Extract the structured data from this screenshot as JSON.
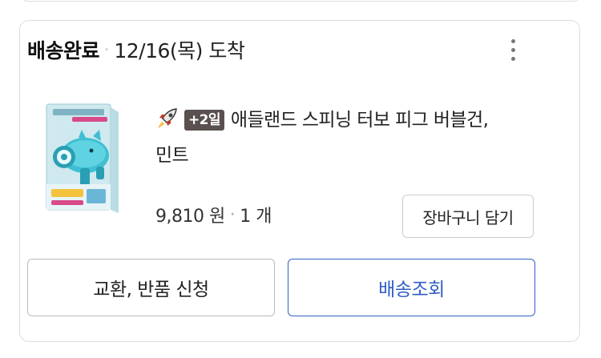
{
  "order": {
    "status": "배송완료",
    "separator": "·",
    "arrival": "12/16(목) 도착"
  },
  "product": {
    "badge": "+2일",
    "title_line1": "애들랜드 스피닝 터보 피그 버블건,",
    "title_line2": "민트",
    "price": "9,810 원",
    "price_separator": "·",
    "quantity": "1 개",
    "thumbnail_icon": "bubble-gun-toy-box-image"
  },
  "actions": {
    "add_to_cart": "장바구니 담기",
    "exchange_return": "교환, 반품 신청",
    "track_delivery": "배송조회"
  },
  "colors": {
    "badge_bg": "#5a5050",
    "track_button_border": "#3461c7",
    "track_button_text": "#2f5cc7"
  }
}
